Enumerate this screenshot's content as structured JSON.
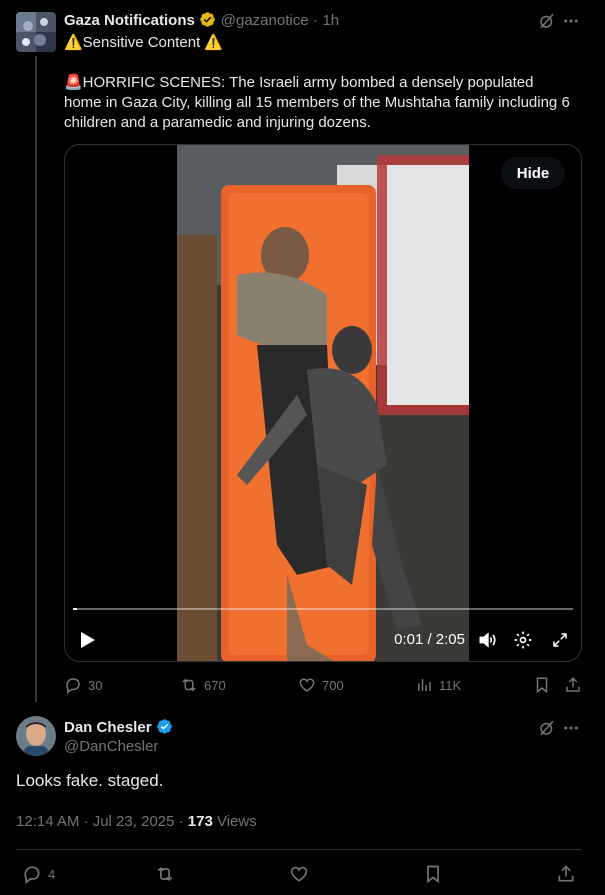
{
  "tweet": {
    "author_name": "Gaza Notifications",
    "handle": "@gazanotice",
    "separator": "·",
    "time_ago": "1h",
    "sensitive_label": "⚠️Sensitive Content ⚠️",
    "body": "🚨HORRIFIC SCENES: The Israeli army bombed a densely populated home in Gaza City, killing all 15 members of the Mushtaha family including 6 children and a paramedic and injuring dozens.",
    "video": {
      "hide_label": "Hide",
      "current_time": "0:01",
      "duration": "2:05",
      "time_display": "0:01 / 2:05",
      "progress_fraction": 0.008
    },
    "stats": {
      "replies": "30",
      "reposts": "670",
      "likes": "700",
      "views": "11K"
    }
  },
  "reply": {
    "author_name": "Dan Chesler",
    "handle": "@DanChesler",
    "text": "Looks fake. staged.",
    "timestamp": "12:14 AM · Jul 23, 2025 ·",
    "views_count": "173",
    "views_label": "Views",
    "stats": {
      "replies": "4"
    }
  },
  "colors": {
    "background": "#000000",
    "text": "#e7e9ea",
    "muted": "#71767b",
    "verified_gold": "#e2b719",
    "verified_blue": "#1d9bf0",
    "stretcher": "#e8622a"
  },
  "icons": [
    "grok-icon",
    "more-icon",
    "play-icon",
    "volume-icon",
    "settings-icon",
    "fullscreen-icon",
    "reply-icon",
    "repost-icon",
    "like-icon",
    "views-icon",
    "bookmark-icon",
    "share-icon"
  ]
}
